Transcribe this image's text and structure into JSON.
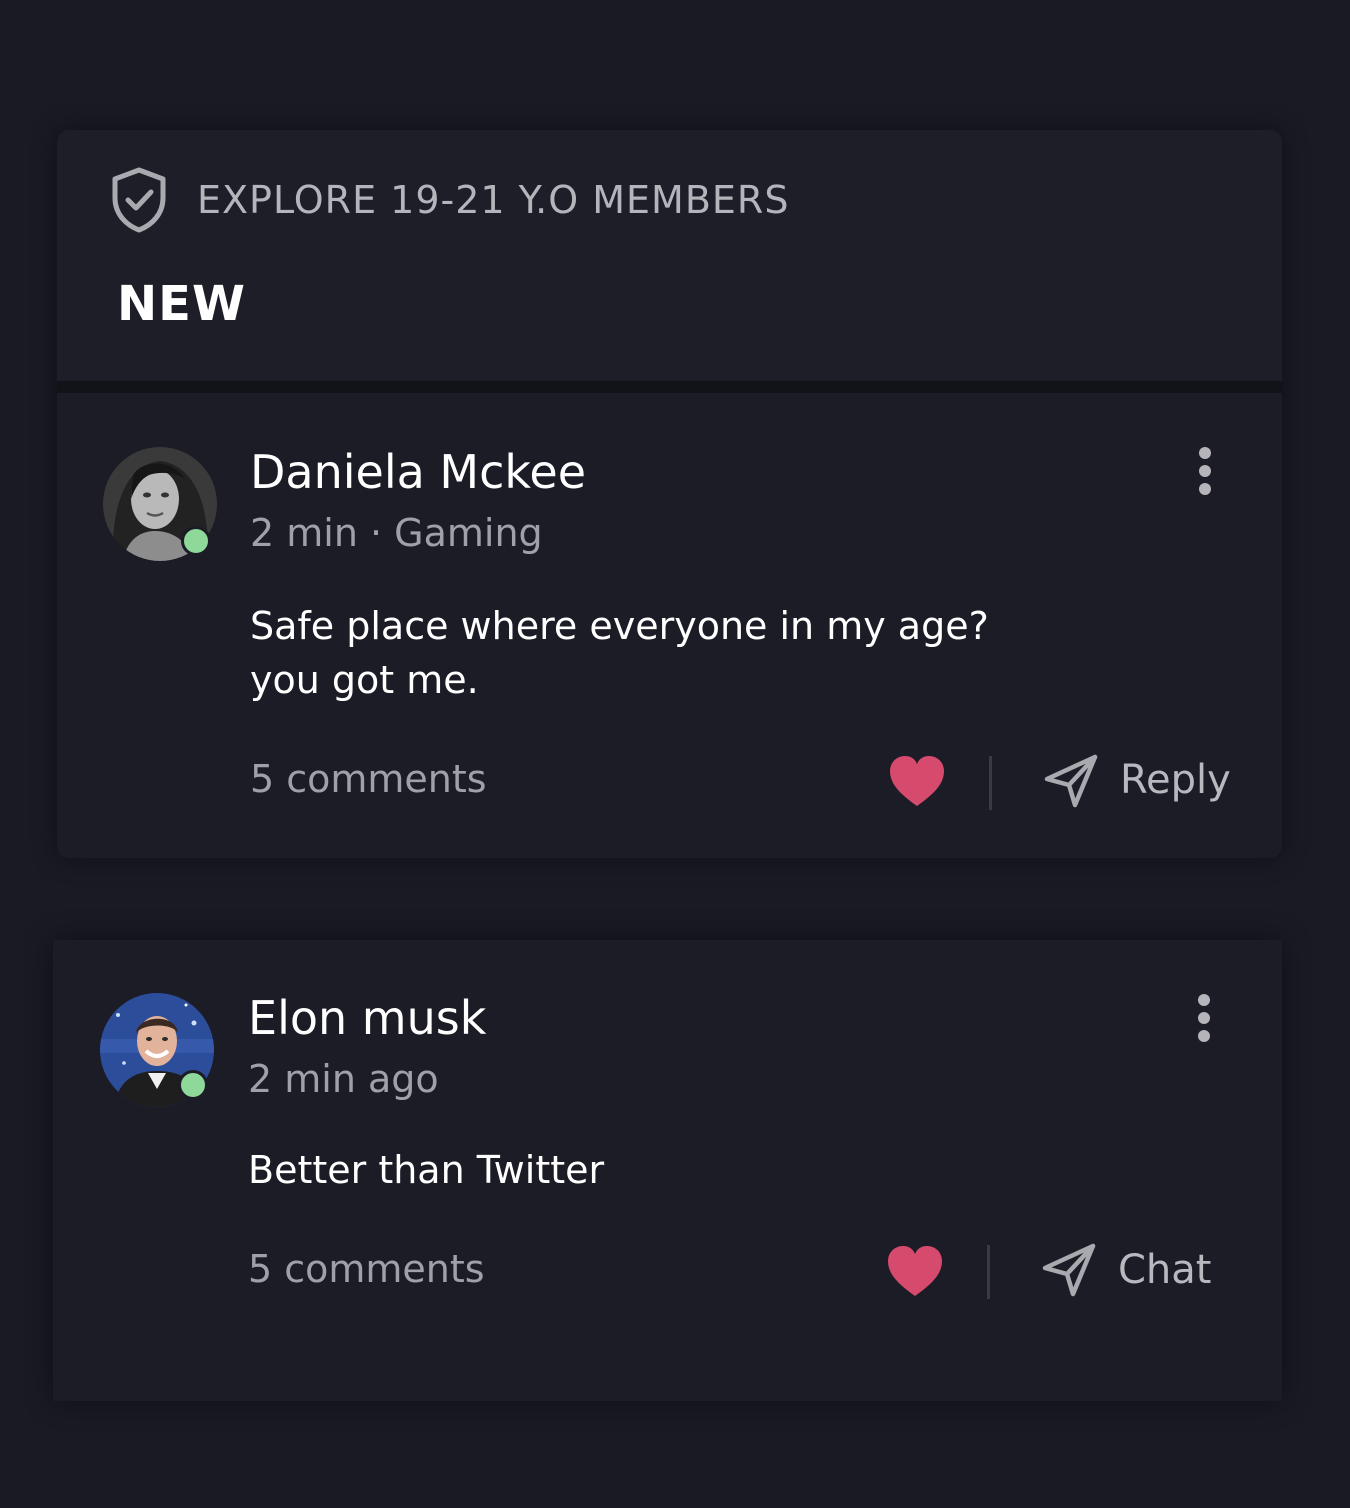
{
  "section": {
    "title": "EXPLORE 19-21 Y.O MEMBERS",
    "icon": "shield-check-icon",
    "label": "NEW"
  },
  "colors": {
    "background": "#1a1a24",
    "card": "#1c1c27",
    "online": "#8ed99a",
    "heart": "#d64a6e"
  },
  "posts": [
    {
      "author": "Daniela Mckee",
      "meta": "2 min · Gaming",
      "body_line1": "Safe place where everyone in my age?",
      "body_line2": "you got me.",
      "comments": "5 comments",
      "action_label": "Reply",
      "online": true
    },
    {
      "author": "Elon musk",
      "meta": "2 min ago",
      "body_line1": "Better than Twitter",
      "comments": "5 comments",
      "action_label": "Chat",
      "online": true
    }
  ]
}
